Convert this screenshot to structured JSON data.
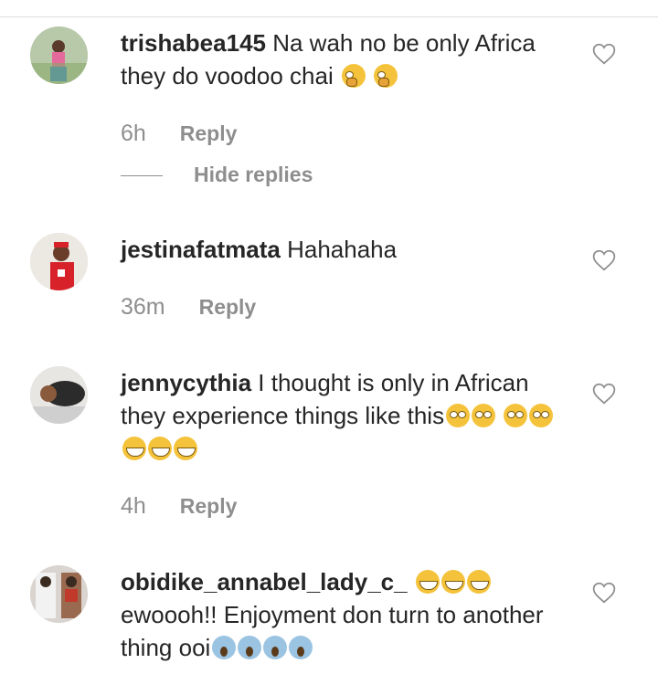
{
  "comments": [
    {
      "username": "trishabea145",
      "text": "Na wah no be only Africa they do voodoo chai",
      "emojis": [
        "thinking-face",
        "thinking-face"
      ],
      "time": "6h",
      "reply_label": "Reply",
      "hide_replies_label": "Hide replies"
    },
    {
      "username": "jestinafatmata",
      "text": "Hahahaha",
      "time": "36m",
      "reply_label": "Reply"
    },
    {
      "username": "jennycythia",
      "text": "I thought is only in African they experience things like this",
      "emojis": [
        "eye-roll-face",
        "eye-roll-face",
        "eye-roll-face",
        "eye-roll-face",
        "grin-face",
        "grin-face",
        "grin-face"
      ],
      "time": "4h",
      "reply_label": "Reply"
    },
    {
      "username": "obidike_annabel_lady_c_",
      "emojis_after_name": [
        "grin-face",
        "grin-face",
        "grin-face"
      ],
      "text": "ewoooh!! Enjoyment don turn to another thing ooi",
      "emojis": [
        "scream-face",
        "scream-face",
        "scream-face",
        "scream-face"
      ]
    }
  ],
  "colors": {
    "text": "#262626",
    "muted": "#8e8e8e",
    "divider": "#dbdbdb"
  },
  "icons": [
    "heart-outline-icon"
  ]
}
